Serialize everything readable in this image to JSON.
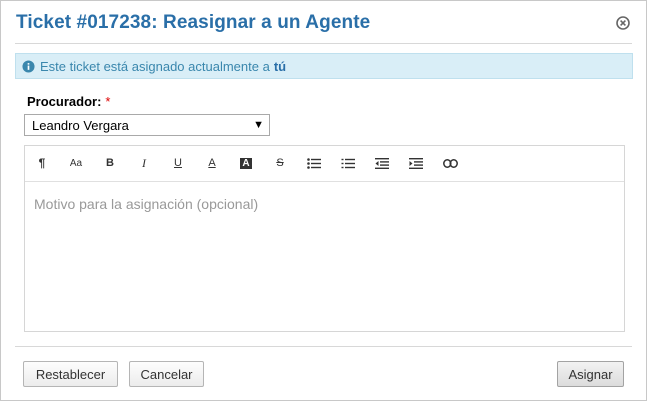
{
  "dialog": {
    "title": "Ticket #017238: Reasignar a un Agente",
    "close_icon": "close-circle-icon"
  },
  "notice": {
    "icon": "info-circle-icon",
    "text": "Este ticket está asignado actualmente a",
    "highlight": "tú",
    "color": "#3a87ad"
  },
  "form": {
    "agent_label": "Procurador:",
    "required_mark": "*",
    "agent_selected": "Leandro Vergara",
    "select_caret": "▼"
  },
  "editor": {
    "toolbar": [
      {
        "name": "paragraph-icon",
        "glyph": "¶"
      },
      {
        "name": "font-size-icon",
        "glyph": "Aa"
      },
      {
        "name": "bold-icon",
        "glyph": "B"
      },
      {
        "name": "italic-icon",
        "glyph": "I"
      },
      {
        "name": "underline-icon",
        "glyph": "U"
      },
      {
        "name": "font-color-icon",
        "glyph": "A"
      },
      {
        "name": "background-color-icon",
        "glyph": "A"
      },
      {
        "name": "strikethrough-icon",
        "glyph": "S"
      },
      {
        "name": "unordered-list-icon"
      },
      {
        "name": "ordered-list-icon"
      },
      {
        "name": "outdent-icon"
      },
      {
        "name": "indent-icon"
      },
      {
        "name": "link-icon"
      }
    ],
    "placeholder": "Motivo para la asignación (opcional)"
  },
  "buttons": {
    "reset": "Restablecer",
    "cancel": "Cancelar",
    "assign": "Asignar"
  },
  "colors": {
    "title": "#2a6fa8",
    "notice_bg": "#d9eef7",
    "required": "#d00000"
  }
}
